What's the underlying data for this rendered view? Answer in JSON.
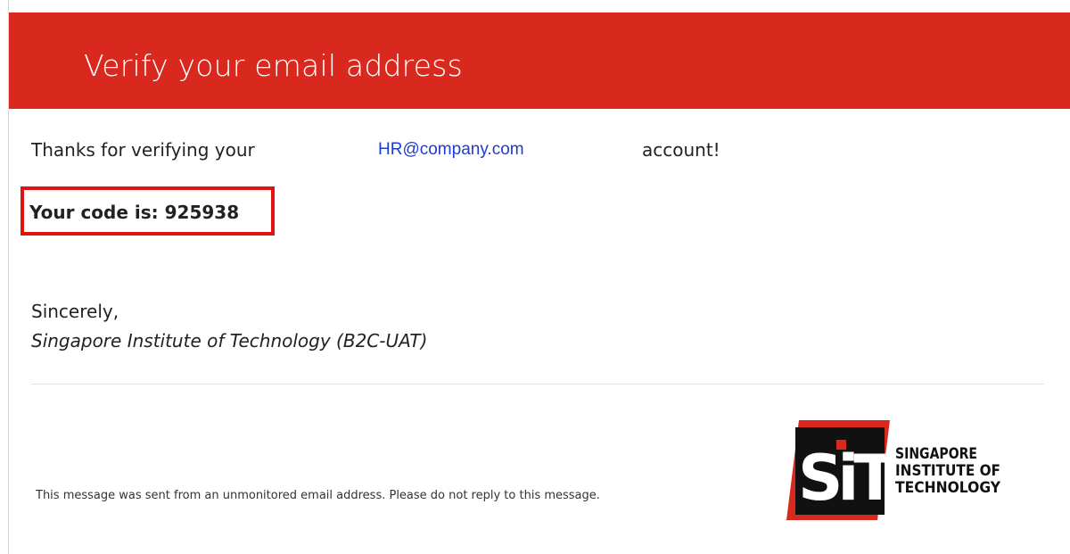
{
  "header": {
    "title": "Verify your email address"
  },
  "body": {
    "thanks_prefix": "Thanks for verifying your",
    "email": "HR@company.com",
    "thanks_suffix": "account!",
    "code_line": "Your code is: 925938",
    "closing": "Sincerely,",
    "signature": "Singapore Institute of Technology (B2C-UAT)"
  },
  "footer": {
    "message": "This message was sent from an unmonitored email address. Please do not reply to this message.",
    "logo_text": {
      "mark": "SIT",
      "line1": "SINGAPORE",
      "line2": "INSTITUTE OF",
      "line3": "TECHNOLOGY"
    }
  },
  "colors": {
    "header_bg": "#d9291e",
    "link": "#1f3ccc",
    "highlight_box": "#e01313"
  }
}
